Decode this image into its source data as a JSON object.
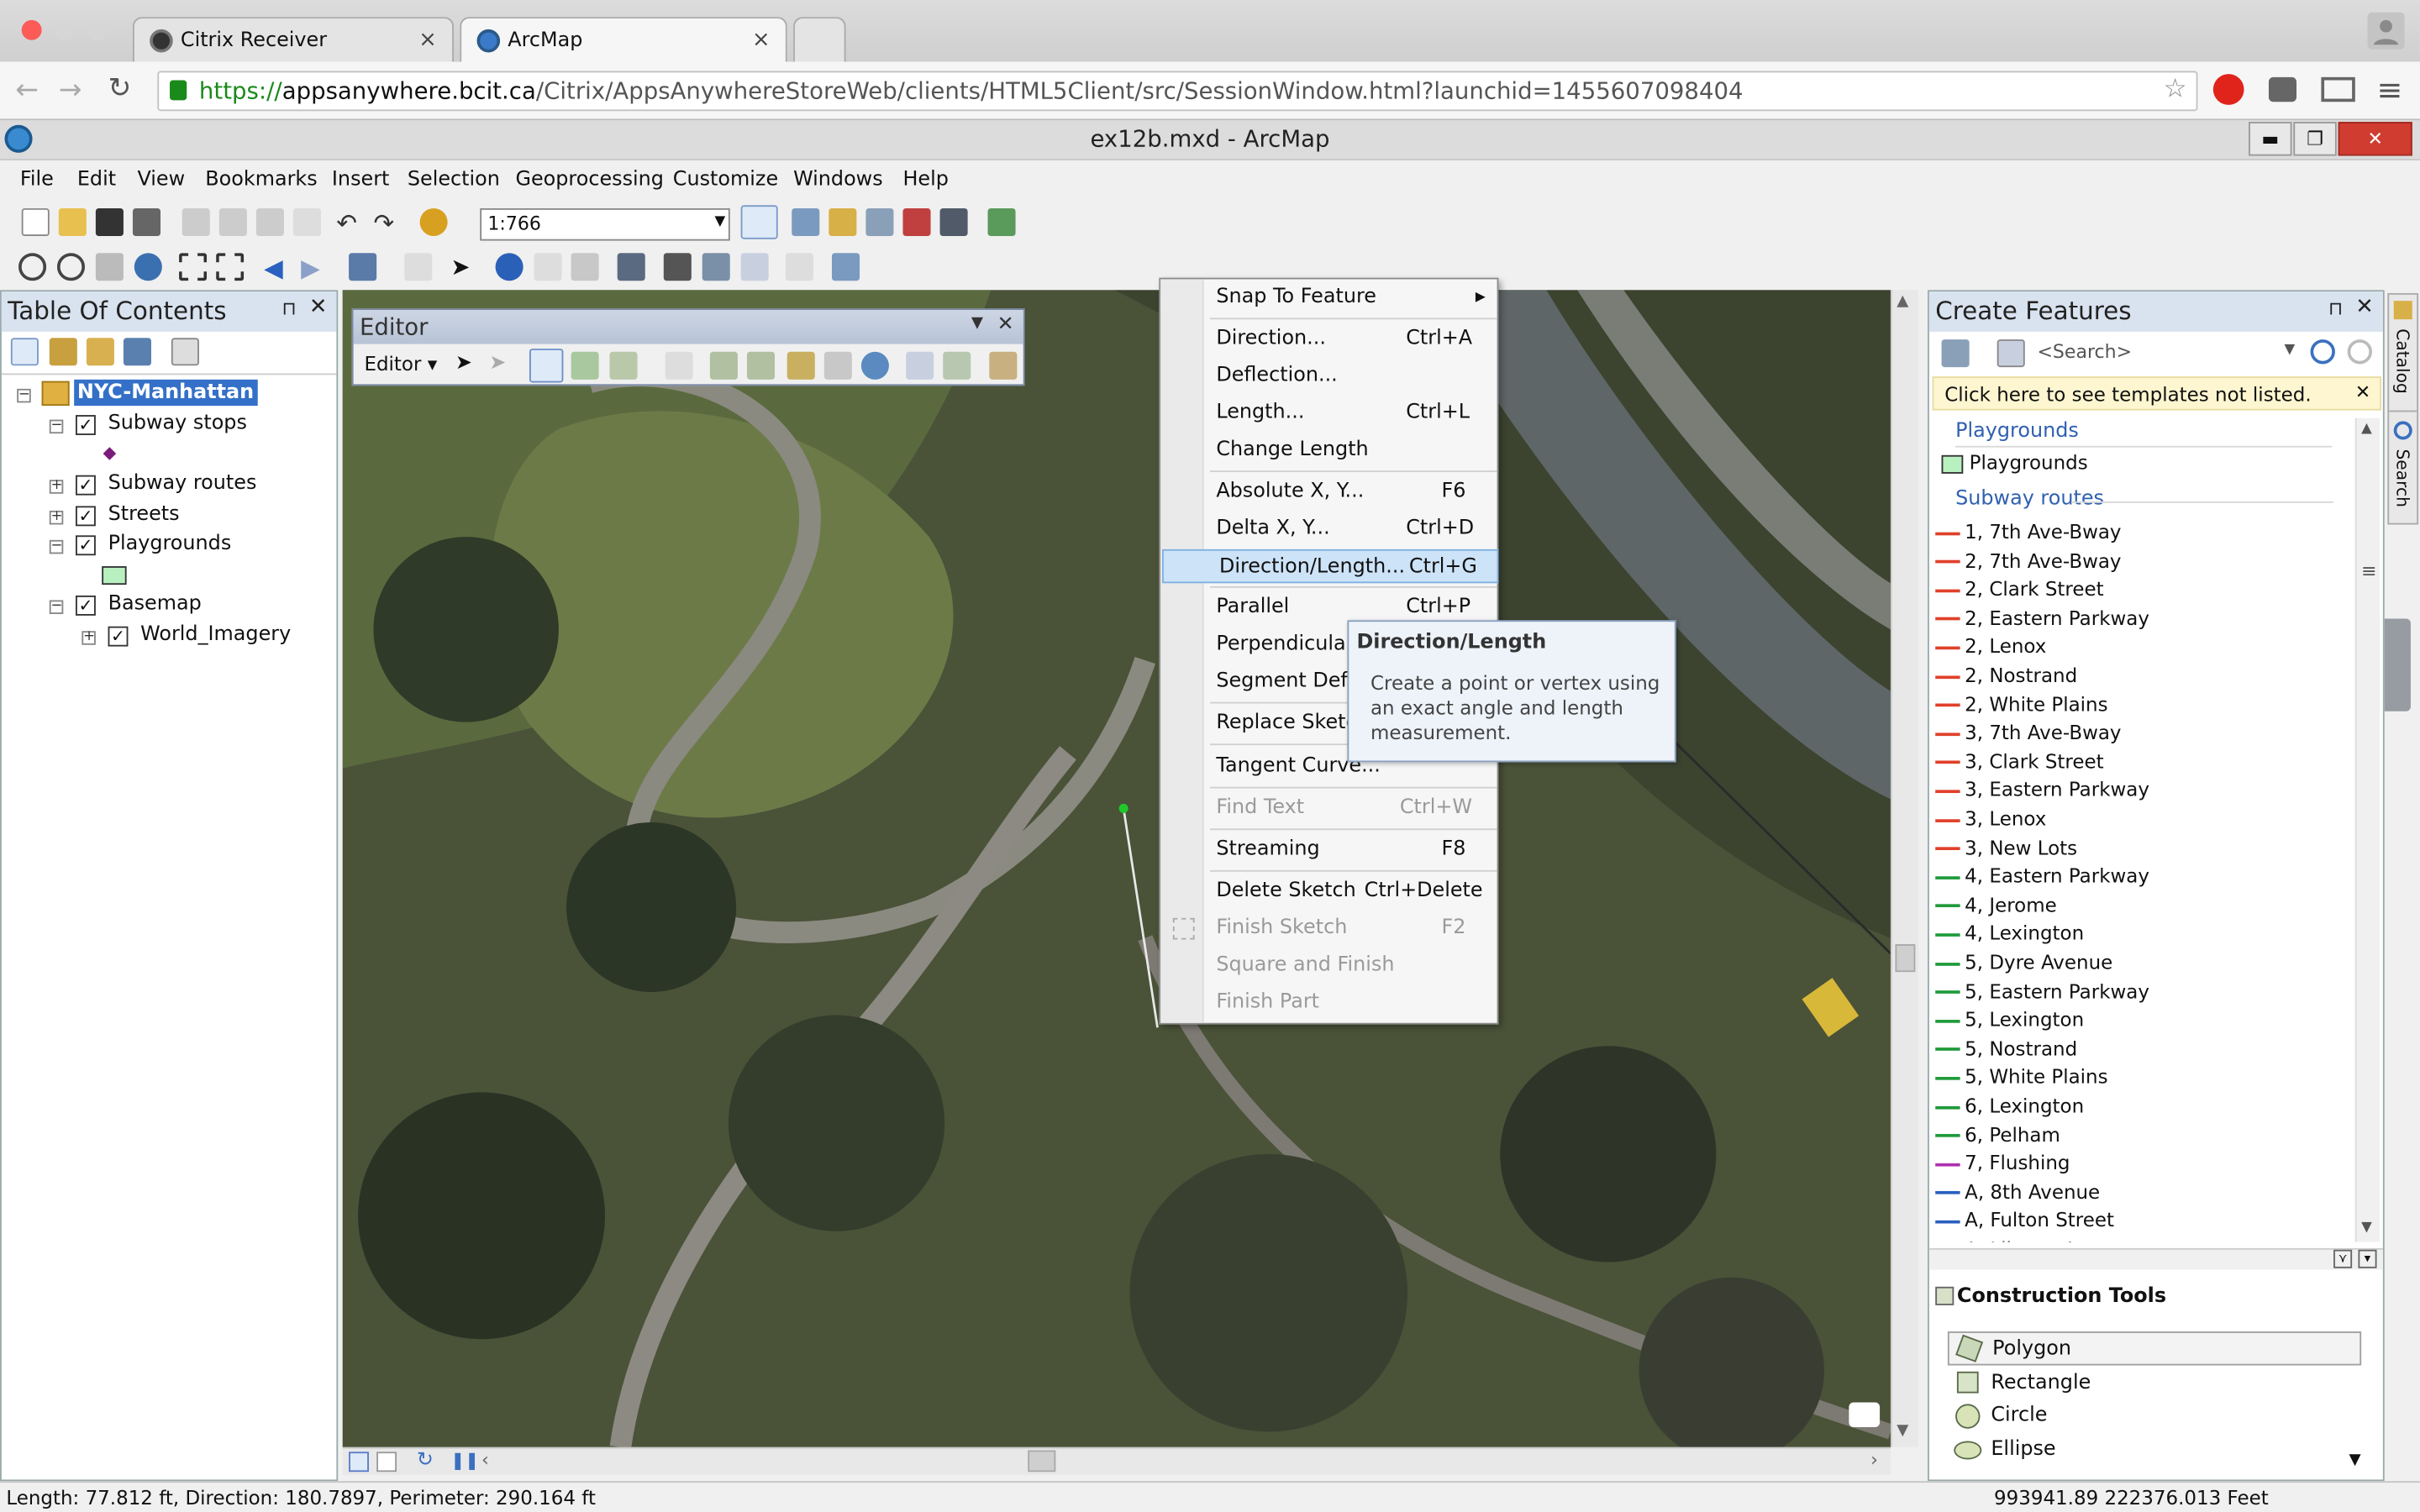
{
  "browser": {
    "tabs": [
      {
        "label": "Citrix Receiver",
        "close": "×"
      },
      {
        "label": "ArcMap",
        "close": "×"
      }
    ],
    "url_scheme": "https://",
    "url_host": "appsanywhere.bcit.ca",
    "url_path": "/Citrix/AppsAnywhereStoreWeb/clients/HTML5Client/src/SessionWindow.html?launchid=1455607098404"
  },
  "app": {
    "title": "ex12b.mxd - ArcMap",
    "window_controls": {
      "min": "▬",
      "max": "❐",
      "close": "✕"
    },
    "menus": [
      "File",
      "Edit",
      "View",
      "Bookmarks",
      "Insert",
      "Selection",
      "Geoprocessing",
      "Customize",
      "Windows",
      "Help"
    ],
    "scale": "1:766"
  },
  "toc": {
    "title": "Table Of Contents",
    "pin": "⊓",
    "close": "✕",
    "root": "NYC-Manhattan",
    "layers": [
      {
        "label": "Subway stops",
        "expander": "−",
        "checked": "✓"
      },
      {
        "label": "Subway routes",
        "expander": "+",
        "checked": "✓"
      },
      {
        "label": "Streets",
        "expander": "+",
        "checked": "✓"
      },
      {
        "label": "Playgrounds",
        "expander": "−",
        "checked": "✓"
      },
      {
        "label": "Basemap",
        "expander": "−",
        "checked": "✓"
      },
      {
        "label": "World_Imagery",
        "expander": "+",
        "checked": "✓"
      }
    ]
  },
  "editor": {
    "title": "Editor",
    "menu_label": "Editor ▾",
    "close": "✕"
  },
  "context_menu": {
    "items": [
      {
        "label": "Snap To Feature",
        "shortcut": "▸",
        "state": "normal"
      },
      {
        "label": "Direction...",
        "shortcut": "Ctrl+A",
        "state": "normal"
      },
      {
        "label": "Deflection...",
        "shortcut": "",
        "state": "normal"
      },
      {
        "label": "Length...",
        "shortcut": "Ctrl+L",
        "state": "normal"
      },
      {
        "label": "Change Length",
        "shortcut": "",
        "state": "normal"
      },
      {
        "label": "Absolute X, Y...",
        "shortcut": "F6",
        "state": "normal"
      },
      {
        "label": "Delta X, Y...",
        "shortcut": "Ctrl+D",
        "state": "normal"
      },
      {
        "label": "Direction/Length...",
        "shortcut": "Ctrl+G",
        "state": "highlighted"
      },
      {
        "label": "Parallel",
        "shortcut": "Ctrl+P",
        "state": "normal"
      },
      {
        "label": "Perpendicular",
        "shortcut": "",
        "state": "normal"
      },
      {
        "label": "Segment Defle",
        "shortcut": "",
        "state": "normal"
      },
      {
        "label": "Replace Sketch",
        "shortcut": "",
        "state": "normal"
      },
      {
        "label": "Tangent Curve...",
        "shortcut": "",
        "state": "normal"
      },
      {
        "label": "Find Text",
        "shortcut": "Ctrl+W",
        "state": "disabled"
      },
      {
        "label": "Streaming",
        "shortcut": "F8",
        "state": "normal"
      },
      {
        "label": "Delete Sketch",
        "shortcut": "Ctrl+Delete",
        "state": "normal"
      },
      {
        "label": "Finish Sketch",
        "shortcut": "F2",
        "state": "disabled"
      },
      {
        "label": "Square and Finish",
        "shortcut": "",
        "state": "disabled"
      },
      {
        "label": "Finish Part",
        "shortcut": "",
        "state": "disabled"
      }
    ]
  },
  "tooltip": {
    "title": "Direction/Length",
    "description": "Create a point or vertex using an exact angle and length measurement."
  },
  "create_features": {
    "title": "Create Features",
    "pin": "⊓",
    "close": "✕",
    "search_placeholder": "<Search>",
    "notice": "Click here to see templates not listed.",
    "notice_close": "✕",
    "group_playgrounds": "Playgrounds",
    "playground_item": "Playgrounds",
    "group_subway": "Subway routes",
    "routes": [
      {
        "label": "1, 7th Ave-Bway",
        "color": "#e0402a"
      },
      {
        "label": "2, 7th Ave-Bway",
        "color": "#e0402a"
      },
      {
        "label": "2, Clark Street",
        "color": "#e0402a"
      },
      {
        "label": "2, Eastern Parkway",
        "color": "#e0402a"
      },
      {
        "label": "2, Lenox",
        "color": "#e0402a"
      },
      {
        "label": "2, Nostrand",
        "color": "#e0402a"
      },
      {
        "label": "2, White Plains",
        "color": "#e0402a"
      },
      {
        "label": "3, 7th Ave-Bway",
        "color": "#e0402a"
      },
      {
        "label": "3, Clark Street",
        "color": "#e0402a"
      },
      {
        "label": "3, Eastern Parkway",
        "color": "#e0402a"
      },
      {
        "label": "3, Lenox",
        "color": "#e0402a"
      },
      {
        "label": "3, New Lots",
        "color": "#e0402a"
      },
      {
        "label": "4, Eastern Parkway",
        "color": "#1f9a3a"
      },
      {
        "label": "4, Jerome",
        "color": "#1f9a3a"
      },
      {
        "label": "4, Lexington",
        "color": "#1f9a3a"
      },
      {
        "label": "5, Dyre Avenue",
        "color": "#1f9a3a"
      },
      {
        "label": "5, Eastern Parkway",
        "color": "#1f9a3a"
      },
      {
        "label": "5, Lexington",
        "color": "#1f9a3a"
      },
      {
        "label": "5, Nostrand",
        "color": "#1f9a3a"
      },
      {
        "label": "5, White Plains",
        "color": "#1f9a3a"
      },
      {
        "label": "6, Lexington",
        "color": "#1f9a3a"
      },
      {
        "label": "6, Pelham",
        "color": "#1f9a3a"
      },
      {
        "label": "7, Flushing",
        "color": "#b030b0"
      },
      {
        "label": "A, 8th Avenue",
        "color": "#2a5fc0"
      },
      {
        "label": "A, Fulton Street",
        "color": "#2a5fc0"
      },
      {
        "label": "A, Liberty Ave",
        "color": "#2a5fc0"
      }
    ],
    "construction_title": "Construction Tools",
    "tools": [
      "Polygon",
      "Rectangle",
      "Circle",
      "Ellipse"
    ]
  },
  "side_tabs": [
    "Catalog",
    "Search"
  ],
  "status": {
    "left": "Length: 77.812 ft, Direction: 180.7897, Perimeter: 290.164 ft",
    "right": "993941.89  222376.013 Feet"
  },
  "colors": {
    "accent": "#3060b0",
    "menu_highlight": "#cde3f8"
  }
}
